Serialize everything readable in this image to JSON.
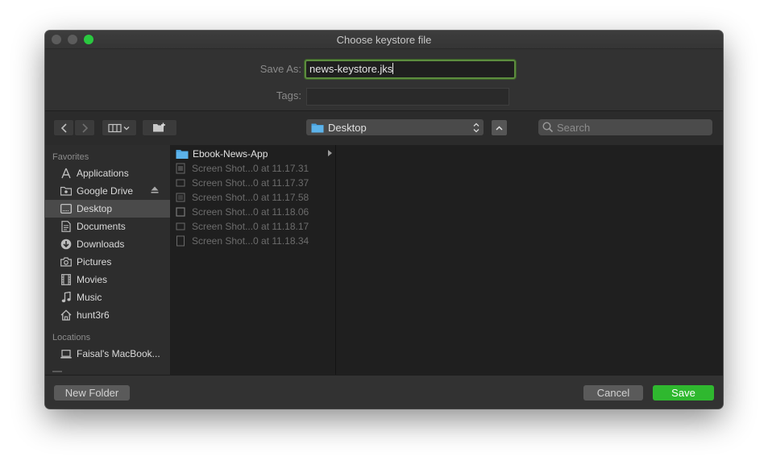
{
  "window": {
    "title": "Choose keystore file"
  },
  "form": {
    "save_as_label": "Save As:",
    "save_as_value": "news-keystore.jks",
    "tags_label": "Tags:",
    "tags_value": ""
  },
  "toolbar": {
    "location": "Desktop",
    "search_placeholder": "Search"
  },
  "sidebar": {
    "favorites_title": "Favorites",
    "favorites": [
      {
        "label": "Applications",
        "icon": "applications-icon"
      },
      {
        "label": "Google Drive",
        "icon": "google-drive-icon"
      },
      {
        "label": "Desktop",
        "icon": "desktop-icon",
        "selected": true
      },
      {
        "label": "Documents",
        "icon": "documents-icon"
      },
      {
        "label": "Downloads",
        "icon": "downloads-icon"
      },
      {
        "label": "Pictures",
        "icon": "pictures-icon"
      },
      {
        "label": "Movies",
        "icon": "movies-icon"
      },
      {
        "label": "Music",
        "icon": "music-icon"
      },
      {
        "label": "hunt3r6",
        "icon": "home-icon"
      }
    ],
    "locations_title": "Locations",
    "locations": [
      {
        "label": "Faisal's MacBook...",
        "icon": "laptop-icon"
      }
    ]
  },
  "files": [
    {
      "name": "Ebook-News-App",
      "type": "folder"
    },
    {
      "name": "Screen Shot...0 at 11.17.31",
      "type": "image"
    },
    {
      "name": "Screen Shot...0 at 11.17.37",
      "type": "image"
    },
    {
      "name": "Screen Shot...0 at 11.17.58",
      "type": "image"
    },
    {
      "name": "Screen Shot...0 at 11.18.06",
      "type": "image"
    },
    {
      "name": "Screen Shot...0 at 11.18.17",
      "type": "image"
    },
    {
      "name": "Screen Shot...0 at 11.18.34",
      "type": "image"
    }
  ],
  "buttons": {
    "new_folder": "New Folder",
    "cancel": "Cancel",
    "save": "Save"
  },
  "colors": {
    "accent_green": "#2fb82f",
    "focus_ring": "#5c8c3e",
    "folder_blue": "#4aa3df",
    "window_bg": "#323232"
  }
}
